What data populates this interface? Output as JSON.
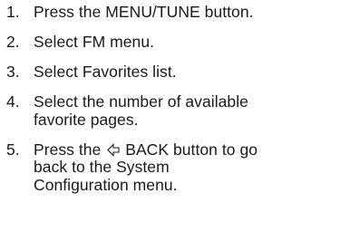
{
  "steps": [
    {
      "num": "1.",
      "text": "Press the MENU/TUNE button."
    },
    {
      "num": "2.",
      "text": "Select FM menu."
    },
    {
      "num": "3.",
      "text": "Select Favorites list."
    },
    {
      "num": "4.",
      "line1": "Select the number of available",
      "line2": "favorite pages."
    },
    {
      "num": "5.",
      "before_icon": "Press the",
      "icon": "back-arrow-icon",
      "after_icon": "BACK button to go",
      "line2": "back to the System",
      "line3": "Configuration menu."
    }
  ]
}
